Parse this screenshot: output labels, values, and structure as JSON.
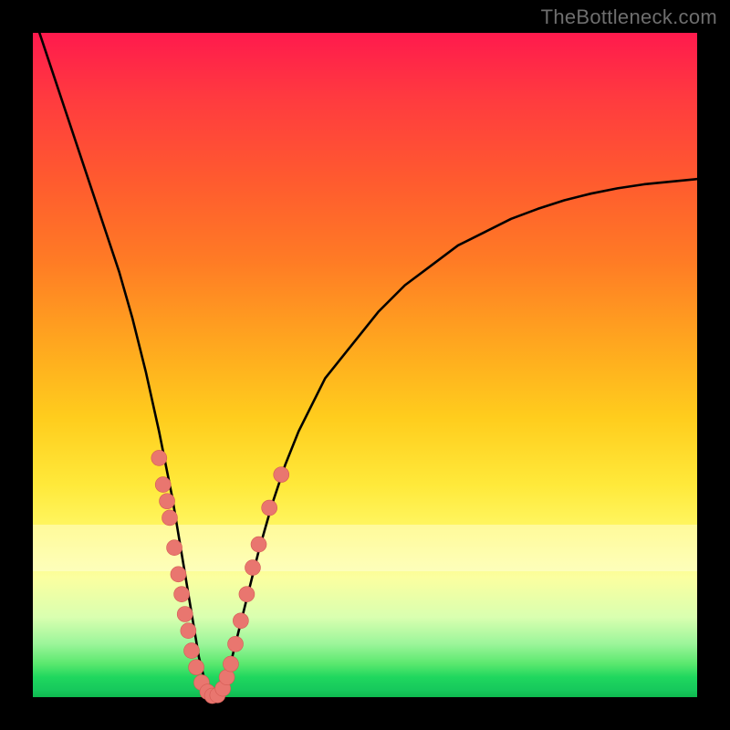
{
  "watermark_text": "TheBottleneck.com",
  "colors": {
    "frame": "#000000",
    "dot_fill": "#e9766f",
    "dot_stroke": "#d45a53",
    "curve": "#000000",
    "gradient_stops": [
      "#ff1a4d",
      "#ff3b3f",
      "#ff5a2f",
      "#ff7a25",
      "#ffa41f",
      "#ffcd1d",
      "#ffe93a",
      "#fff96a",
      "#fbffa0",
      "#d9ffb0",
      "#9bf59a",
      "#5ae86e",
      "#1fd75e",
      "#16c85c",
      "#0eb94e"
    ]
  },
  "chart_data": {
    "type": "line",
    "title": "",
    "xlabel": "",
    "ylabel": "",
    "xlim": [
      0,
      100
    ],
    "ylim": [
      0,
      100
    ],
    "grid": false,
    "legend": false,
    "annotations": [],
    "series": [
      {
        "name": "bottleneck-curve",
        "x": [
          1,
          3,
          5,
          7,
          9,
          11,
          13,
          15,
          17,
          19,
          20,
          21,
          22,
          23,
          24,
          25,
          26,
          27,
          28,
          29,
          30,
          32,
          34,
          36,
          38,
          40,
          44,
          48,
          52,
          56,
          60,
          64,
          68,
          72,
          76,
          80,
          84,
          88,
          92,
          96,
          100
        ],
        "values": [
          100,
          94,
          88,
          82,
          76,
          70,
          64,
          57,
          49,
          40,
          35,
          30,
          24,
          18,
          12,
          6,
          2,
          0,
          0,
          2,
          6,
          14,
          22,
          29,
          35,
          40,
          48,
          53,
          58,
          62,
          65,
          68,
          70,
          72,
          73.5,
          74.8,
          75.8,
          76.6,
          77.2,
          77.6,
          78
        ]
      }
    ],
    "scatter": {
      "name": "sample-points",
      "points": [
        {
          "x": 19.0,
          "y": 36.0
        },
        {
          "x": 19.6,
          "y": 32.0
        },
        {
          "x": 20.2,
          "y": 29.5
        },
        {
          "x": 20.6,
          "y": 27.0
        },
        {
          "x": 21.3,
          "y": 22.5
        },
        {
          "x": 21.9,
          "y": 18.5
        },
        {
          "x": 22.4,
          "y": 15.5
        },
        {
          "x": 22.9,
          "y": 12.5
        },
        {
          "x": 23.4,
          "y": 10.0
        },
        {
          "x": 23.9,
          "y": 7.0
        },
        {
          "x": 24.6,
          "y": 4.5
        },
        {
          "x": 25.4,
          "y": 2.2
        },
        {
          "x": 26.3,
          "y": 0.8
        },
        {
          "x": 27.0,
          "y": 0.2
        },
        {
          "x": 27.8,
          "y": 0.3
        },
        {
          "x": 28.6,
          "y": 1.3
        },
        {
          "x": 29.2,
          "y": 3.0
        },
        {
          "x": 29.8,
          "y": 5.0
        },
        {
          "x": 30.5,
          "y": 8.0
        },
        {
          "x": 31.3,
          "y": 11.5
        },
        {
          "x": 32.2,
          "y": 15.5
        },
        {
          "x": 33.1,
          "y": 19.5
        },
        {
          "x": 34.0,
          "y": 23.0
        },
        {
          "x": 35.6,
          "y": 28.5
        },
        {
          "x": 37.4,
          "y": 33.5
        }
      ]
    },
    "pale_band": {
      "y_bottom": 19,
      "y_top": 26
    }
  }
}
